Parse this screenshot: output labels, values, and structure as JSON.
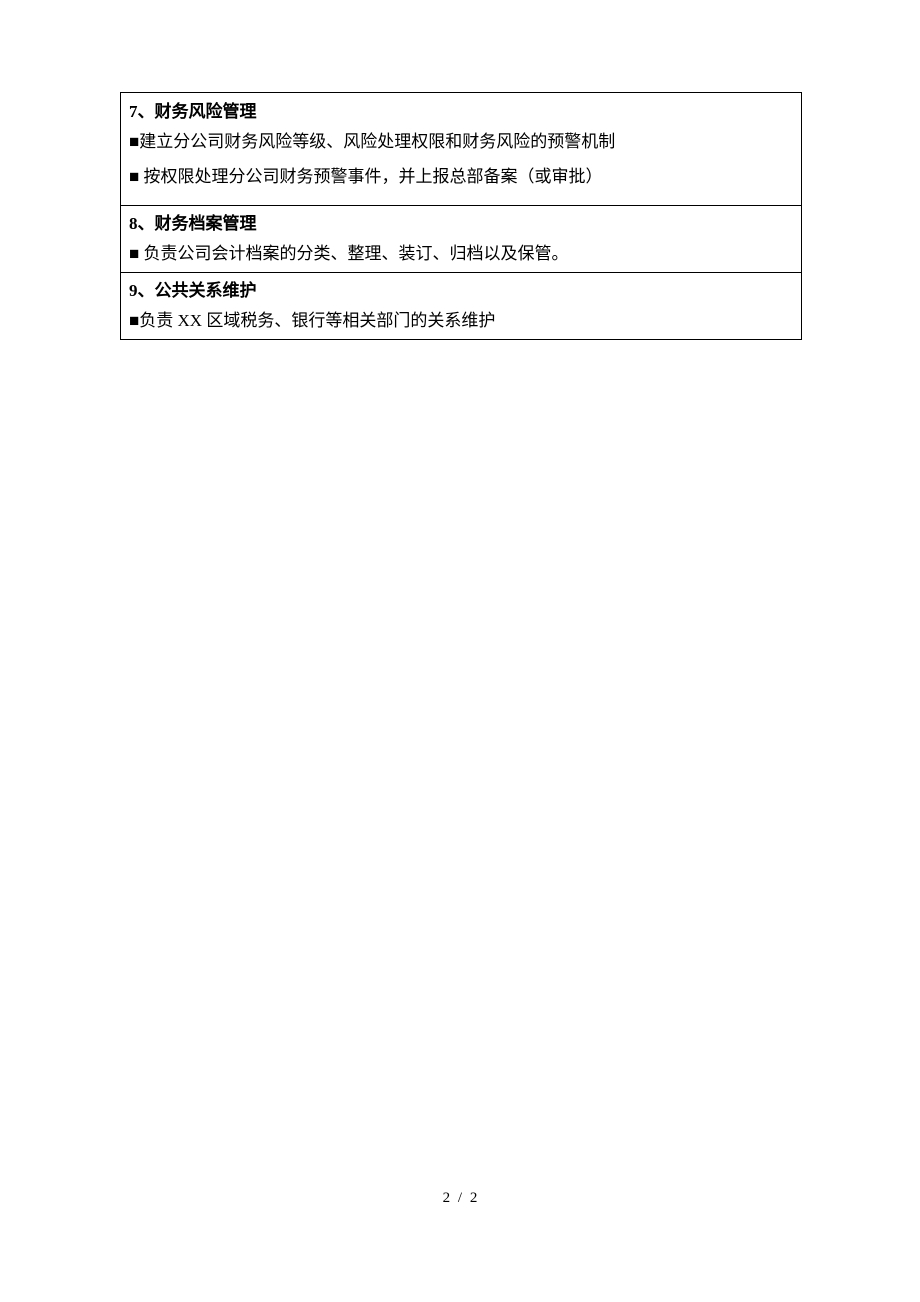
{
  "sections": [
    {
      "heading": "7、财务风险管理",
      "bullets": [
        "■建立分公司财务风险等级、风险处理权限和财务风险的预警机制",
        "■ 按权限处理分公司财务预警事件，并上报总部备案（或审批）"
      ]
    },
    {
      "heading": "8、财务档案管理",
      "bullets": [
        "■  负责公司会计档案的分类、整理、装订、归档以及保管。"
      ]
    },
    {
      "heading": "9、公共关系维护",
      "bullets": [
        "■负责 XX 区域税务、银行等相关部门的关系维护"
      ]
    }
  ],
  "page_number": "2 / 2"
}
